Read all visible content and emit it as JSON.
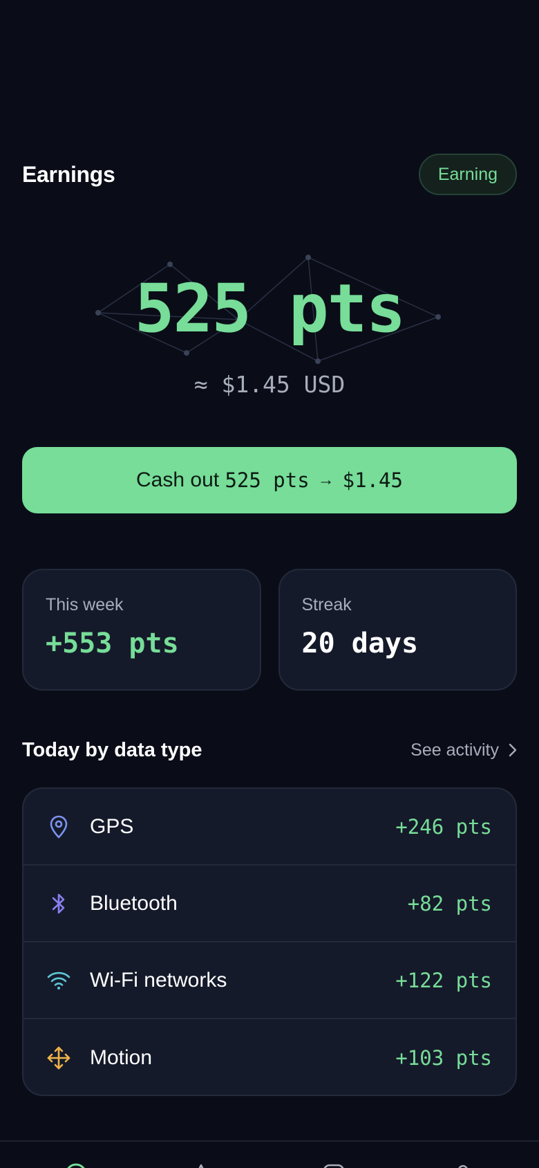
{
  "header": {
    "title": "Earnings",
    "status_badge": "Earning"
  },
  "balance": {
    "points": "525 pts",
    "usd": "≈ $1.45 USD"
  },
  "cashout": {
    "prefix": "Cash out ",
    "points": "525 pts",
    "arrow": "→",
    "amount": "$1.45"
  },
  "stats": [
    {
      "label": "This week",
      "value": "+553 pts"
    },
    {
      "label": "Streak",
      "value": "20 days"
    }
  ],
  "section": {
    "title": "Today by data type",
    "link": "See activity"
  },
  "data_types": [
    {
      "icon": "location-pin-icon",
      "name": "GPS",
      "points": "+246 pts",
      "color": "#7d93ee"
    },
    {
      "icon": "bluetooth-icon",
      "name": "Bluetooth",
      "points": "+82 pts",
      "color": "#8a7ff0"
    },
    {
      "icon": "wifi-icon",
      "name": "Wi-Fi networks",
      "points": "+122 pts",
      "color": "#5cc8d6"
    },
    {
      "icon": "move-arrows-icon",
      "name": "Motion",
      "points": "+103 pts",
      "color": "#f0b449"
    }
  ],
  "bottom_nav": {
    "items": [
      "home-icon",
      "triangle-icon",
      "chat-icon",
      "profile-icon"
    ]
  },
  "colors": {
    "accent": "#77dd98",
    "background": "#0a0d18",
    "card": "#151a2a",
    "muted_text": "#a8adbb"
  }
}
